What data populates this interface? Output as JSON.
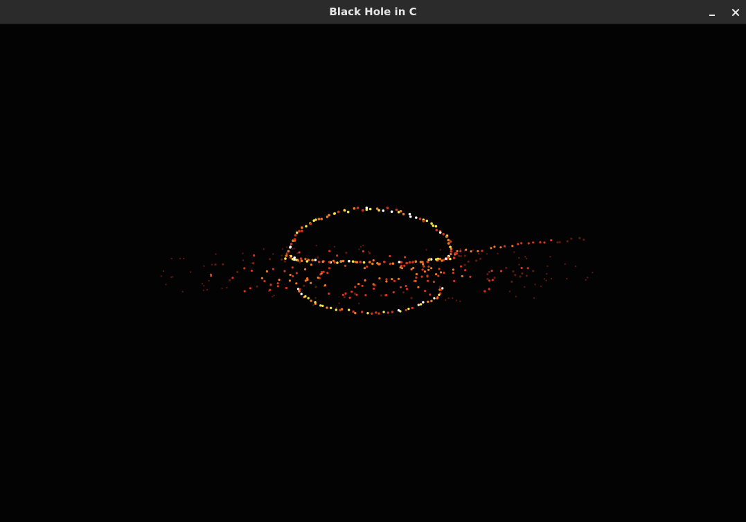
{
  "window": {
    "title": "Black Hole in C"
  },
  "controls": {
    "minimize_icon": "minimize-icon",
    "close_icon": "close-icon"
  },
  "colors": {
    "titlebar": "#2b2b2b",
    "title_text": "#e6e6e6",
    "background": "#030303",
    "particle_white": "#ffffff",
    "particle_yellow": "#f4e64a",
    "particle_orange": "#f07a22",
    "particle_red": "#d8341c",
    "particle_dim": "#5a1a0c"
  }
}
